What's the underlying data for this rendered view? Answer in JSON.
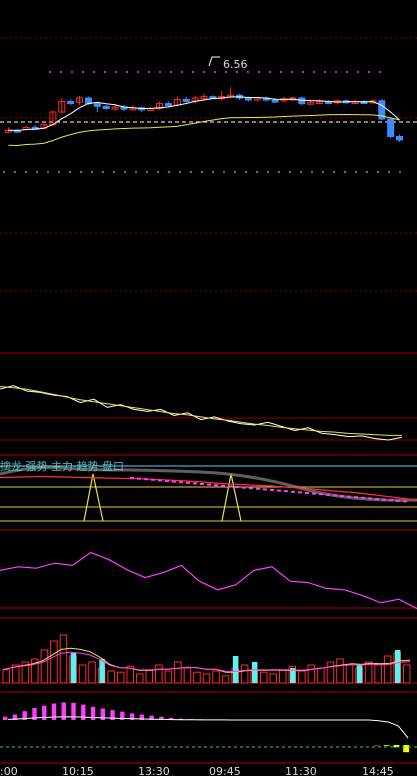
{
  "price_label": "6.56",
  "indicator_legend": "擒龙·强势·主力·趋势·盘口",
  "time_axis": [
    ":00",
    "10:15",
    "13:30",
    "09:45",
    "11:30",
    "14:45"
  ],
  "colors": {
    "background": "#000000",
    "grid_red": "#8b0000",
    "candle_up": "#ff2a2a",
    "candle_down": "#3b8cff",
    "candle_flat": "#ffffff",
    "ma_white": "#ffffff",
    "ma_yellow": "#e6e64c",
    "magenta": "#ff3cff",
    "cyan_bar": "#5cf0f0",
    "green_dots": "#2bd92b"
  },
  "chart_data": [
    {
      "type": "candlestick",
      "title": "",
      "annotation": "6.56",
      "candles_ohlc_relative": [
        [
          0.12,
          0.14,
          0.18,
          0.11
        ],
        [
          0.14,
          0.13,
          0.16,
          0.1
        ],
        [
          0.15,
          0.18,
          0.2,
          0.13
        ],
        [
          0.18,
          0.17,
          0.21,
          0.15
        ],
        [
          0.17,
          0.22,
          0.24,
          0.15
        ],
        [
          0.22,
          0.4,
          0.42,
          0.2
        ],
        [
          0.4,
          0.55,
          0.6,
          0.38
        ],
        [
          0.55,
          0.54,
          0.58,
          0.5
        ],
        [
          0.54,
          0.6,
          0.63,
          0.5
        ],
        [
          0.6,
          0.52,
          0.62,
          0.5
        ],
        [
          0.52,
          0.48,
          0.54,
          0.4
        ],
        [
          0.48,
          0.45,
          0.5,
          0.43
        ],
        [
          0.45,
          0.47,
          0.5,
          0.42
        ],
        [
          0.47,
          0.44,
          0.5,
          0.41
        ],
        [
          0.44,
          0.46,
          0.5,
          0.42
        ],
        [
          0.46,
          0.43,
          0.48,
          0.4
        ],
        [
          0.43,
          0.45,
          0.48,
          0.41
        ],
        [
          0.45,
          0.52,
          0.55,
          0.43
        ],
        [
          0.52,
          0.5,
          0.55,
          0.47
        ],
        [
          0.5,
          0.58,
          0.62,
          0.48
        ],
        [
          0.58,
          0.56,
          0.62,
          0.53
        ],
        [
          0.56,
          0.6,
          0.63,
          0.52
        ],
        [
          0.6,
          0.62,
          0.66,
          0.58
        ],
        [
          0.62,
          0.6,
          0.64,
          0.58
        ],
        [
          0.6,
          0.62,
          0.7,
          0.56
        ],
        [
          0.62,
          0.64,
          0.76,
          0.6
        ],
        [
          0.64,
          0.6,
          0.66,
          0.57
        ],
        [
          0.6,
          0.58,
          0.62,
          0.55
        ],
        [
          0.58,
          0.6,
          0.62,
          0.56
        ],
        [
          0.6,
          0.57,
          0.62,
          0.55
        ],
        [
          0.57,
          0.56,
          0.6,
          0.53
        ],
        [
          0.56,
          0.59,
          0.62,
          0.54
        ],
        [
          0.59,
          0.6,
          0.62,
          0.57
        ],
        [
          0.6,
          0.52,
          0.62,
          0.5
        ],
        [
          0.52,
          0.54,
          0.58,
          0.51
        ],
        [
          0.54,
          0.55,
          0.58,
          0.52
        ],
        [
          0.55,
          0.54,
          0.57,
          0.51
        ],
        [
          0.54,
          0.56,
          0.58,
          0.52
        ],
        [
          0.56,
          0.54,
          0.58,
          0.52
        ],
        [
          0.54,
          0.55,
          0.58,
          0.52
        ],
        [
          0.55,
          0.53,
          0.57,
          0.51
        ],
        [
          0.53,
          0.56,
          0.58,
          0.52
        ],
        [
          0.56,
          0.3,
          0.58,
          0.28
        ],
        [
          0.3,
          0.05,
          0.32,
          0.02
        ],
        [
          0.05,
          0.0,
          0.08,
          -0.03
        ]
      ]
    },
    {
      "type": "line",
      "title": "",
      "series": [
        {
          "values": [
            0.75,
            0.8,
            0.72,
            0.7,
            0.66,
            0.64,
            0.55,
            0.6,
            0.48,
            0.52,
            0.45,
            0.42,
            0.45,
            0.36,
            0.4,
            0.3,
            0.34,
            0.28,
            0.24,
            0.22,
            0.26,
            0.2,
            0.14,
            0.18,
            0.1,
            0.08,
            0.05,
            0.06,
            0.02,
            0.0,
            0.04
          ]
        },
        {
          "values": [
            0.78,
            0.76,
            0.74,
            0.7,
            0.66,
            0.62,
            0.58,
            0.55,
            0.52,
            0.49,
            0.46,
            0.43,
            0.4,
            0.37,
            0.35,
            0.32,
            0.29,
            0.27,
            0.24,
            0.21,
            0.19,
            0.16,
            0.14,
            0.12,
            0.1,
            0.09,
            0.07,
            0.06,
            0.05,
            0.04,
            0.04
          ]
        }
      ]
    },
    {
      "type": "line",
      "title": "",
      "spike_positions": [
        0.22,
        0.56
      ],
      "series": [
        {
          "values": [
            0.85,
            0.86,
            0.87,
            0.86,
            0.85,
            0.84,
            0.83,
            0.82,
            0.8,
            0.78,
            0.75,
            0.72,
            0.7,
            0.68,
            0.65,
            0.62,
            0.58,
            0.55,
            0.5,
            0.45,
            0.4
          ]
        }
      ]
    },
    {
      "type": "line",
      "title": "",
      "series": [
        {
          "values": [
            0.55,
            0.6,
            0.58,
            0.65,
            0.62,
            0.8,
            0.7,
            0.56,
            0.45,
            0.52,
            0.62,
            0.4,
            0.28,
            0.35,
            0.55,
            0.6,
            0.4,
            0.38,
            0.3,
            0.28,
            0.2,
            0.1,
            0.15,
            0.02
          ]
        }
      ]
    },
    {
      "type": "bar",
      "title": "",
      "values_red": [
        0.22,
        0.3,
        0.35,
        0.4,
        0.55,
        0.7,
        0.8,
        0.45,
        0.3,
        0.35,
        0.25,
        0.2,
        0.18,
        0.28,
        0.15,
        0.22,
        0.3,
        0.2,
        0.35,
        0.25,
        0.18,
        0.15,
        0.2,
        0.12,
        0.25,
        0.3,
        0.2,
        0.18,
        0.15,
        0.22,
        0.28,
        0.2,
        0.3,
        0.25,
        0.35,
        0.4,
        0.3,
        0.25,
        0.35,
        0.3,
        0.45,
        0.5,
        0.3
      ],
      "values_cyan": [
        0.0,
        0.0,
        0.0,
        0.0,
        0.0,
        0.0,
        0.0,
        0.5,
        0.0,
        0.0,
        0.4,
        0.0,
        0.0,
        0.0,
        0.0,
        0.0,
        0.0,
        0.0,
        0.0,
        0.0,
        0.0,
        0.0,
        0.0,
        0.0,
        0.45,
        0.0,
        0.35,
        0.0,
        0.0,
        0.0,
        0.25,
        0.0,
        0.0,
        0.0,
        0.0,
        0.0,
        0.0,
        0.3,
        0.0,
        0.0,
        0.0,
        0.55,
        0.0
      ]
    },
    {
      "type": "bar",
      "title": "",
      "histogram": [
        0.15,
        0.25,
        0.4,
        0.55,
        0.65,
        0.75,
        0.8,
        0.78,
        0.7,
        0.6,
        0.52,
        0.45,
        0.38,
        0.3,
        0.25,
        0.2,
        0.15,
        0.1,
        0.06,
        0.04,
        0.03,
        0.02,
        0.02,
        0.01,
        0.01,
        0.0,
        0.0,
        0.0,
        0.0,
        0.0,
        0.0,
        0.0,
        0.0,
        0.0,
        0.0,
        0.0,
        0.0,
        0.0,
        -0.02,
        -0.05,
        -0.15,
        -0.45
      ]
    }
  ]
}
